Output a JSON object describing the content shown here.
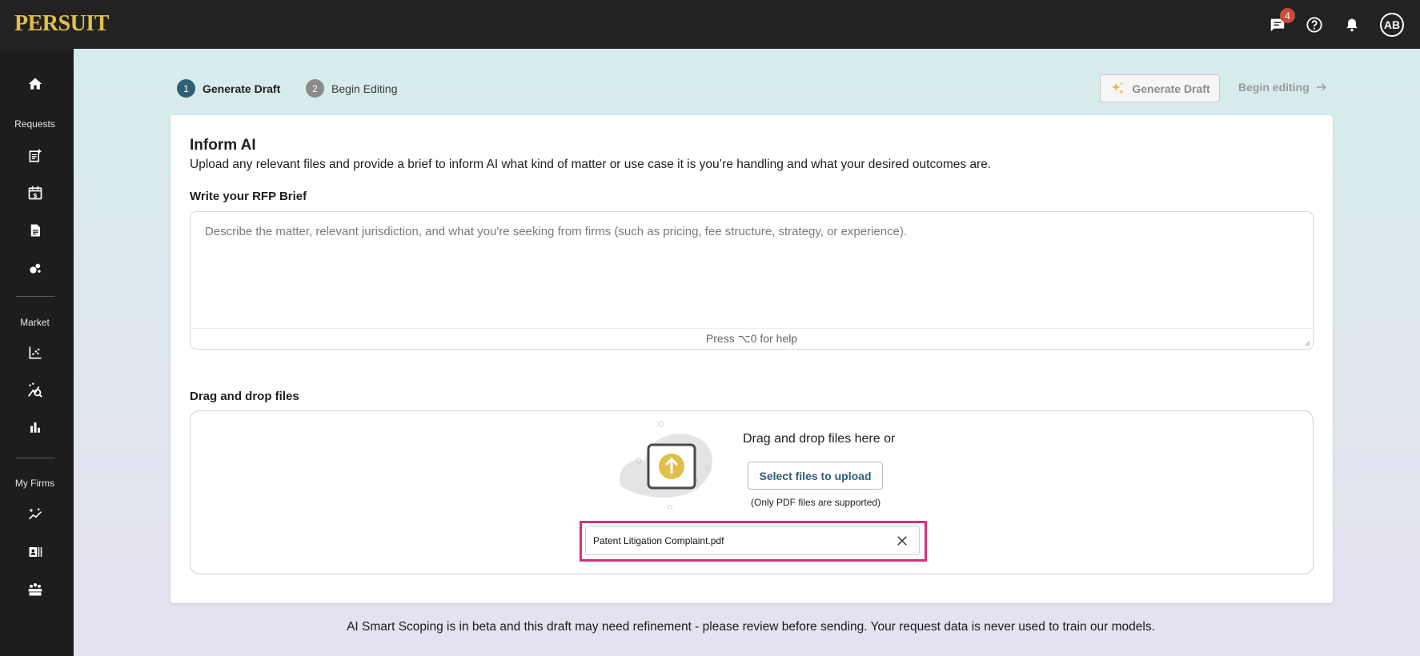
{
  "app": {
    "logo": "PERSUIT"
  },
  "topbar": {
    "messages_count": "4",
    "avatar_initials": "AB"
  },
  "sidebar": {
    "sections": {
      "requests": "Requests",
      "market": "Market",
      "my_firms": "My Firms"
    }
  },
  "steps": [
    {
      "number": "1",
      "label": "Generate Draft"
    },
    {
      "number": "2",
      "label": "Begin Editing"
    }
  ],
  "actions": {
    "generate_draft": "Generate Draft",
    "begin_editing": "Begin editing"
  },
  "card": {
    "title": "Inform AI",
    "description": "Upload any relevant files and provide a brief to inform AI what kind of matter or use case it is you’re handling and what your desired outcomes are.",
    "brief_label": "Write your RFP Brief",
    "brief_placeholder": "Describe the matter, relevant jurisdiction, and what you're seeking from firms (such as pricing, fee structure, strategy, or experience).",
    "brief_help": "Press ⌥0 for help",
    "drop_label": "Drag and drop files",
    "drop_text": "Drag and drop files here or",
    "select_button": "Select files to upload",
    "pdf_note": "(Only PDF files are supported)",
    "uploaded_file": "Patent Litigation Complaint.pdf"
  },
  "footer": {
    "note": "AI Smart Scoping is in beta and this draft may need refinement - please review before sending. Your request data is never used to train our models."
  },
  "colors": {
    "accent_gold": "#e2bf48",
    "step_active": "#2d6175",
    "highlight": "#d6317a"
  }
}
